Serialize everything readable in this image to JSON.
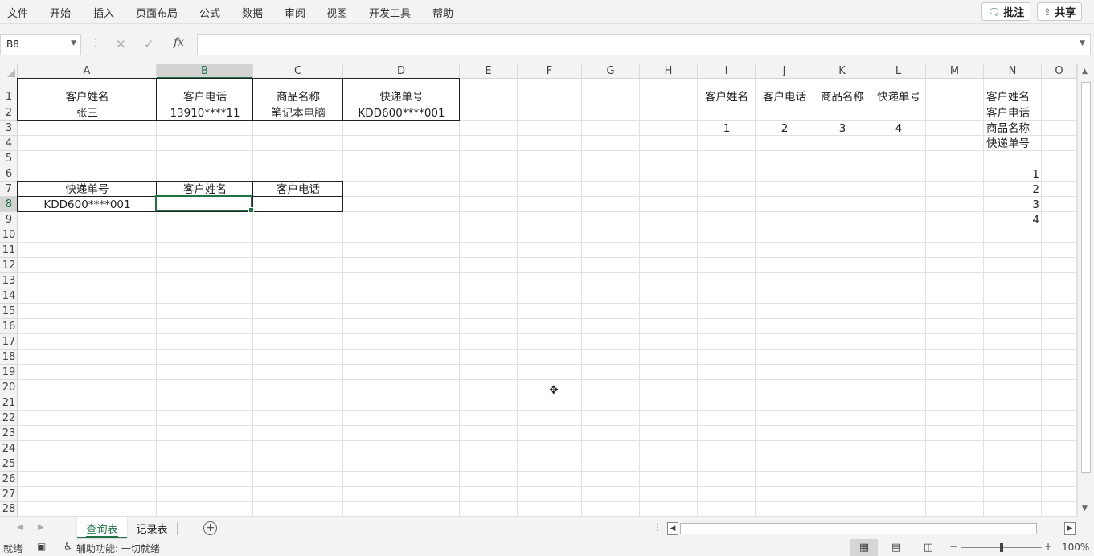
{
  "ribbon": {
    "tabs": [
      "文件",
      "开始",
      "插入",
      "页面布局",
      "公式",
      "数据",
      "审阅",
      "视图",
      "开发工具",
      "帮助"
    ],
    "comment_label": "批注",
    "share_label": "共享"
  },
  "formula_bar": {
    "name_box": "B8",
    "fx_label": "fx",
    "formula": ""
  },
  "columns": [
    "A",
    "B",
    "C",
    "D",
    "E",
    "F",
    "G",
    "H",
    "I",
    "J",
    "K",
    "L",
    "M",
    "N",
    "O"
  ],
  "selected_column": "B",
  "rows": [
    "1",
    "2",
    "3",
    "4",
    "5",
    "6",
    "7",
    "8",
    "9",
    "10",
    "11",
    "12",
    "13",
    "14",
    "15",
    "16",
    "17",
    "18",
    "19",
    "20",
    "21",
    "22",
    "23",
    "24",
    "25",
    "26",
    "27",
    "28"
  ],
  "selected_row": "8",
  "cells": {
    "A1": "客户姓名",
    "B1": "客户电话",
    "C1": "商品名称",
    "D1": "快递单号",
    "A2": "张三",
    "B2": "13910****11",
    "C2": "笔记本电脑",
    "D2": "KDD600****001",
    "A7": "快递单号",
    "B7": "客户姓名",
    "C7": "客户电话",
    "A8": "KDD600****001",
    "B8": "",
    "I1": "客户姓名",
    "J1": "客户电话",
    "K1": "商品名称",
    "L1": "快递单号",
    "I3": "1",
    "J3": "2",
    "K3": "3",
    "L3": "4",
    "N1": "客户姓名",
    "N2": "客户电话",
    "N3": "商品名称",
    "N4": "快递单号",
    "N6": "1",
    "N7": "2",
    "N8": "3",
    "N9": "4"
  },
  "sheets": [
    "查询表",
    "记录表"
  ],
  "active_sheet": "查询表",
  "status": {
    "ready": "就绪",
    "accessibility": "辅助功能: 一切就绪",
    "zoom": "100%"
  },
  "accent_color": "#217346"
}
